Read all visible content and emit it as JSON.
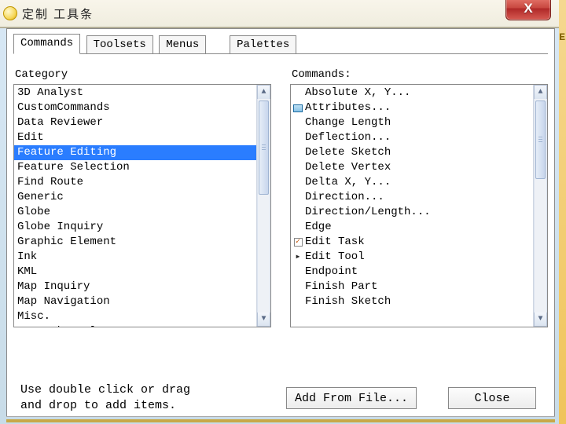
{
  "window": {
    "title": "定制 工具条"
  },
  "tabs": {
    "commands": "Commands",
    "toolsets": "Toolsets",
    "menus": "Menus",
    "palettes": "Palettes"
  },
  "labels": {
    "category": "Category",
    "commands": "Commands:"
  },
  "categories": {
    "items": [
      "3D Analyst",
      "CustomCommands",
      "Data Reviewer",
      "Edit",
      "Feature Editing",
      "Feature Selection",
      "Find Route",
      "Generic",
      "Globe",
      "Globe Inquiry",
      "Graphic Element",
      "Ink",
      "KML",
      "Map Inquiry",
      "Map Navigation",
      "Misc.",
      "Network Analyst"
    ],
    "selected_index": 4
  },
  "commands": {
    "items": [
      {
        "icon": "",
        "label": "Absolute X, Y..."
      },
      {
        "icon": "grid",
        "label": "Attributes..."
      },
      {
        "icon": "",
        "label": "Change Length"
      },
      {
        "icon": "",
        "label": "Deflection..."
      },
      {
        "icon": "",
        "label": "Delete Sketch"
      },
      {
        "icon": "",
        "label": "Delete Vertex"
      },
      {
        "icon": "",
        "label": "Delta X, Y..."
      },
      {
        "icon": "",
        "label": "Direction..."
      },
      {
        "icon": "",
        "label": "Direction/Length..."
      },
      {
        "icon": "",
        "label": "Edge"
      },
      {
        "icon": "check",
        "label": "Edit Task"
      },
      {
        "icon": "arrow",
        "label": "Edit Tool"
      },
      {
        "icon": "",
        "label": "Endpoint"
      },
      {
        "icon": "",
        "label": "Finish Part"
      },
      {
        "icon": "",
        "label": "Finish Sketch"
      }
    ]
  },
  "hint": {
    "line1": "Use double click or drag",
    "line2": "and drop to add items."
  },
  "buttons": {
    "add_from_file": "Add From File...",
    "close": "Close"
  },
  "colors": {
    "selection": "#2a7dff",
    "titlebar_bg": "#f4f1e6",
    "close_bg": "#c84840"
  }
}
